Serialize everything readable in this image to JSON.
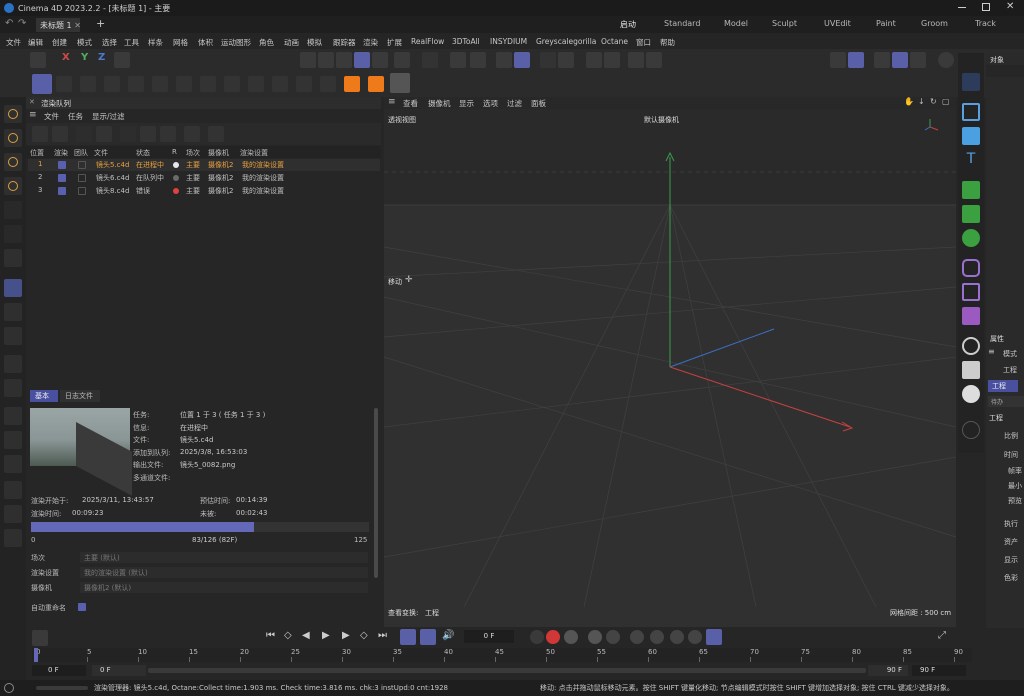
{
  "app": {
    "title": "Cinema 4D 2023.2.2 - [未标题 1] - 主要",
    "document_tab": "未标题 1",
    "add_tab": "+"
  },
  "layouts": [
    {
      "label": "启动",
      "active": true
    },
    {
      "label": "Standard"
    },
    {
      "label": "Model"
    },
    {
      "label": "Sculpt"
    },
    {
      "label": "UVEdit"
    },
    {
      "label": "Paint"
    },
    {
      "label": "Groom"
    },
    {
      "label": "Track"
    }
  ],
  "menus": [
    "文件",
    "编辑",
    "创建",
    "模式",
    "选择",
    "工具",
    "样条",
    "网格",
    "体积",
    "运动图形",
    "角色",
    "动画",
    "模拟",
    "跟踪器",
    "渲染",
    "扩展",
    "RealFlow",
    "3DToAll",
    "INSYDIUM",
    "Greyscalegorilla",
    "Octane",
    "窗口",
    "帮助"
  ],
  "toolbar": {
    "axis_x": "X",
    "axis_y": "Y",
    "axis_z": "Z"
  },
  "render_queue": {
    "title": "渲染队列",
    "menu": [
      "文件",
      "任务",
      "显示/过滤"
    ],
    "columns": [
      "位置",
      "渲染",
      "团队",
      "文件",
      "状态",
      "R",
      "场次",
      "摄像机",
      "渲染设置"
    ],
    "rows": [
      {
        "pos": "1",
        "render": true,
        "team": false,
        "file": "镜头5.c4d",
        "status": "在进程中",
        "r_color": "#e8e8e8",
        "take": "主要",
        "camera": "摄像机2",
        "settings": "我的渲染设置",
        "highlight": true
      },
      {
        "pos": "2",
        "render": true,
        "team": false,
        "file": "镜头6.c4d",
        "status": "在队列中",
        "r_color": "#6a6a6a",
        "take": "主要",
        "camera": "摄像机2",
        "settings": "我的渲染设置",
        "highlight": false
      },
      {
        "pos": "3",
        "render": true,
        "team": false,
        "file": "镜头8.c4d",
        "status": "错误",
        "r_color": "#e04040",
        "take": "主要",
        "camera": "摄像机2",
        "settings": "我的渲染设置",
        "highlight": false
      }
    ],
    "detail_tabs": [
      "基本",
      "日志文件"
    ],
    "details": [
      {
        "k": "任务:",
        "v": "位置 1 于 3 ( 任务 1 于 3 )"
      },
      {
        "k": "信息:",
        "v": "在进程中"
      },
      {
        "k": "文件:",
        "v": "镜头5.c4d"
      },
      {
        "k": "添加到队列:",
        "v": "2025/3/8, 16:53:03"
      },
      {
        "k": "输出文件:",
        "v": "镜头5_0082.png"
      },
      {
        "k": "多通道文件:",
        "v": ""
      }
    ],
    "render_start_label": "渲染开始于:",
    "render_start": "2025/3/11, 13:43:57",
    "estimated_label": "预估时间:",
    "estimated": "00:14:39",
    "render_time_label": "渲染时间:",
    "render_time": "00:09:23",
    "remaining_label": "未被:",
    "remaining": "00:02:43",
    "progress": {
      "fraction": 0.66,
      "min": "0",
      "max": "125",
      "text": "83/126 (82F)"
    },
    "fields": [
      {
        "k": "场次",
        "v": "主要 (默认)"
      },
      {
        "k": "渲染设置",
        "v": "我的渲染设置 (默认)"
      },
      {
        "k": "摄像机",
        "v": "摄像机2 (默认)"
      }
    ],
    "auto_rename": "自动重命名"
  },
  "viewport": {
    "menu": [
      "查看",
      "摄像机",
      "显示",
      "选项",
      "过滤",
      "面板"
    ],
    "view_name": "透视视图",
    "camera": "默认摄像机",
    "move": "移动",
    "info_left": "查看变换:",
    "info_left_val": "工程",
    "grid": "网格间距 : 500 cm"
  },
  "right_panel": {
    "objects_tab": "对象",
    "attr_tab": "属性",
    "mode": "模式",
    "project": "工程",
    "project_btn": "工程",
    "section": "工程",
    "items": [
      "比例",
      "时间",
      "帧率",
      "最小",
      "预览",
      "执行",
      "资产",
      "显示",
      "色彩"
    ],
    "search": "待办"
  },
  "timeline": {
    "frame_field": "0 F",
    "ticks": [
      "0",
      "5",
      "10",
      "15",
      "20",
      "25",
      "30",
      "35",
      "40",
      "45",
      "50",
      "55",
      "60",
      "65",
      "70",
      "75",
      "80",
      "85",
      "90"
    ],
    "start": "0 F",
    "start2": "0 F",
    "end": "90 F",
    "end2": "90 F"
  },
  "status": {
    "left": "渲染管理器: 镜头5.c4d, Octane:Collect time:1.903 ms. Check time:3.816 ms. chk:3 instUpd:0 cnt:1928",
    "right": "移动: 点击并拖动鼠标移动元素。按住 SHIFT 键量化移动; 节点编辑模式时按住 SHIFT 键增加选择对象; 按住 CTRL 键减少选择对象。"
  },
  "colors": {
    "accent": "#5a60b0",
    "highlight_text": "#e8a040",
    "x_axis": "#c84040",
    "y_axis": "#3c9c50",
    "z_axis": "#3c70c8"
  }
}
